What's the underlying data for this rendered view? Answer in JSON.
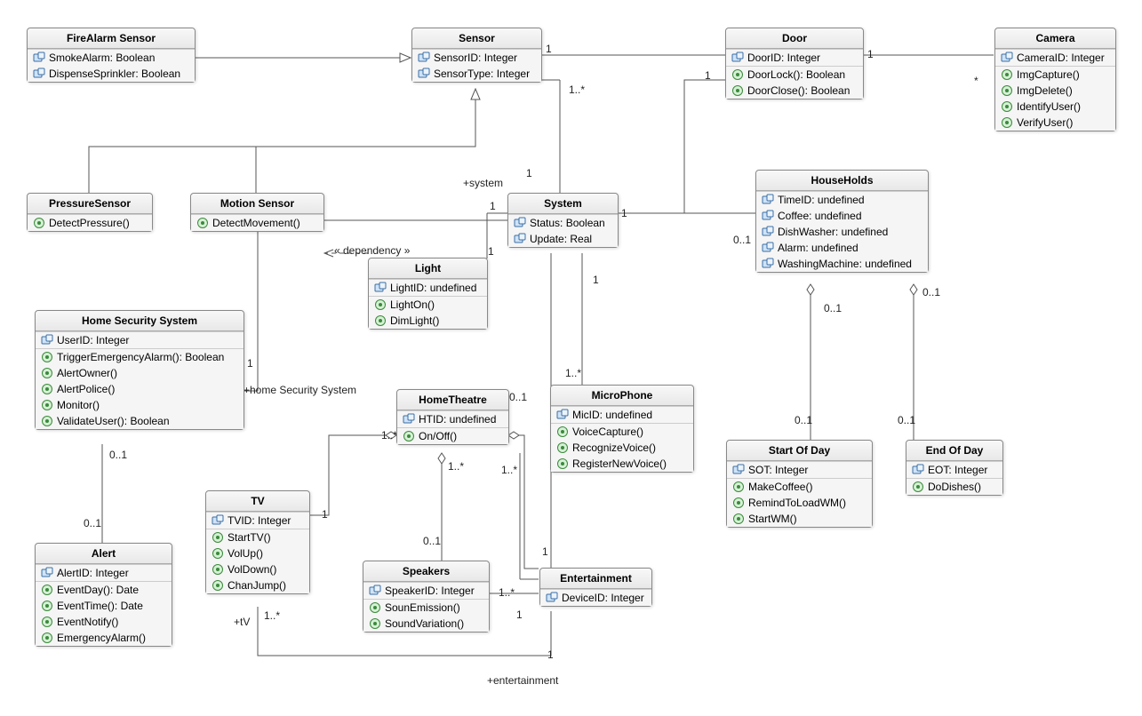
{
  "classes": {
    "fireAlarm": {
      "name": "FireAlarm Sensor",
      "attrs": [
        "SmokeAlarm: Boolean",
        "DispenseSprinkler: Boolean"
      ],
      "ops": []
    },
    "sensor": {
      "name": "Sensor",
      "attrs": [
        "SensorID: Integer",
        "SensorType: Integer"
      ],
      "ops": []
    },
    "door": {
      "name": "Door",
      "attrs": [
        "DoorID: Integer"
      ],
      "ops": [
        "DoorLock(): Boolean",
        "DoorClose(): Boolean"
      ]
    },
    "camera": {
      "name": "Camera",
      "attrs": [
        "CameraID: Integer"
      ],
      "ops": [
        "ImgCapture()",
        "ImgDelete()",
        "IdentifyUser()",
        "VerifyUser()"
      ]
    },
    "pressure": {
      "name": "PressureSensor",
      "attrs": [],
      "ops": [
        "DetectPressure()"
      ]
    },
    "motion": {
      "name": "Motion Sensor",
      "attrs": [],
      "ops": [
        "DetectMovement()"
      ]
    },
    "system": {
      "name": "System",
      "attrs": [
        "Status: Boolean",
        "Update: Real"
      ],
      "ops": []
    },
    "households": {
      "name": "HouseHolds",
      "attrs": [
        "TimeID: undefined",
        "Coffee: undefined",
        "DishWasher: undefined",
        "Alarm: undefined",
        "WashingMachine: undefined"
      ],
      "ops": []
    },
    "light": {
      "name": "Light",
      "attrs": [
        "LightID: undefined"
      ],
      "ops": [
        "LightOn()",
        "DimLight()"
      ]
    },
    "hss": {
      "name": "Home Security System",
      "attrs": [
        "UserID: Integer"
      ],
      "ops": [
        "TriggerEmergencyAlarm(): Boolean",
        "AlertOwner()",
        "AlertPolice()",
        "Monitor()",
        "ValidateUser(): Boolean"
      ]
    },
    "homeTheatre": {
      "name": "HomeTheatre",
      "attrs": [
        "HTID: undefined"
      ],
      "ops": [
        "On/Off()"
      ]
    },
    "microphone": {
      "name": "MicroPhone",
      "attrs": [
        "MicID: undefined"
      ],
      "ops": [
        "VoiceCapture()",
        "RecognizeVoice()",
        "RegisterNewVoice()"
      ]
    },
    "startOfDay": {
      "name": "Start Of Day",
      "attrs": [
        "SOT: Integer"
      ],
      "ops": [
        "MakeCoffee()",
        "RemindToLoadWM()",
        "StartWM()"
      ]
    },
    "endOfDay": {
      "name": "End Of Day",
      "attrs": [
        "EOT: Integer"
      ],
      "ops": [
        "DoDishes()"
      ]
    },
    "tv": {
      "name": "TV",
      "attrs": [
        "TVID: Integer"
      ],
      "ops": [
        "StartTV()",
        "VolUp()",
        "VolDown()",
        "ChanJump()"
      ]
    },
    "alert": {
      "name": "Alert",
      "attrs": [
        "AlertID: Integer"
      ],
      "ops": [
        "EventDay(): Date",
        "EventTime(): Date",
        "EventNotify()",
        "EmergencyAlarm()"
      ]
    },
    "speakers": {
      "name": "Speakers",
      "attrs": [
        "SpeakerID: Integer"
      ],
      "ops": [
        "SounEmission()",
        "SoundVariation()"
      ]
    },
    "entertainment": {
      "name": "Entertainment",
      "attrs": [
        "DeviceID: Integer"
      ],
      "ops": []
    }
  },
  "labels": {
    "dependency": "« dependency »",
    "system": "+system",
    "hss": "+home Security System",
    "tv": "+tV",
    "entertainment": "+entertainment",
    "one": "1",
    "oneStar": "1..*",
    "star": "*",
    "zeroOne": "0..1"
  }
}
